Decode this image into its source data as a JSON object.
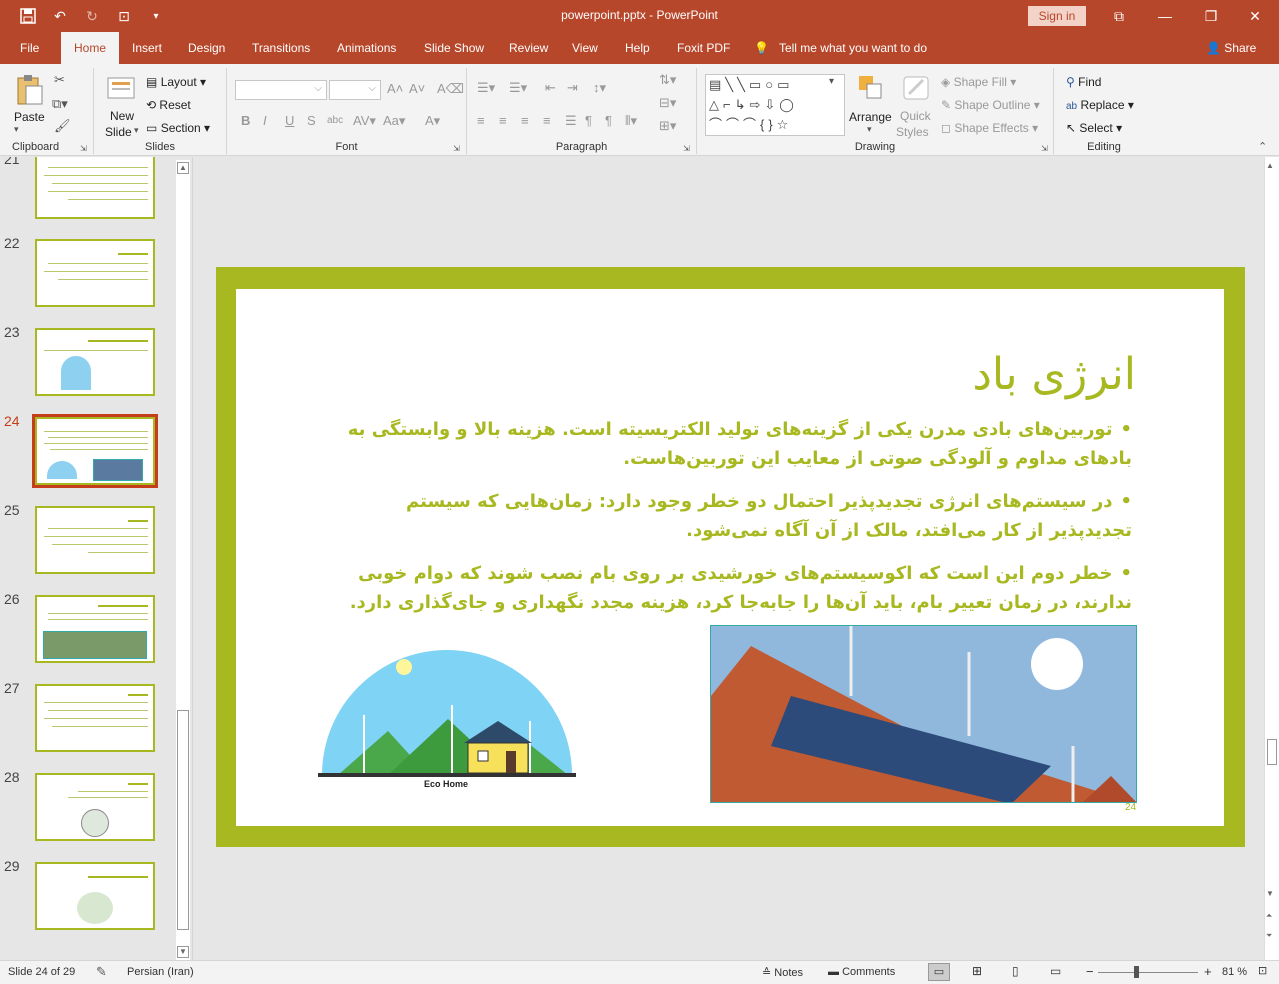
{
  "window": {
    "title": "powerpoint.pptx - PowerPoint",
    "signin": "Sign in"
  },
  "tabs": [
    "File",
    "Home",
    "Insert",
    "Design",
    "Transitions",
    "Animations",
    "Slide Show",
    "Review",
    "View",
    "Help",
    "Foxit PDF"
  ],
  "active_tab": "Home",
  "tell_me": "Tell me what you want to do",
  "share": "Share",
  "ribbon": {
    "clipboard": {
      "label": "Clipboard",
      "paste": "Paste"
    },
    "slides": {
      "label": "Slides",
      "new_slide_1": "New",
      "new_slide_2": "Slide",
      "layout": "Layout",
      "reset": "Reset",
      "section": "Section"
    },
    "font": {
      "label": "Font"
    },
    "paragraph": {
      "label": "Paragraph"
    },
    "drawing": {
      "label": "Drawing",
      "arrange": "Arrange",
      "quick_styles_1": "Quick",
      "quick_styles_2": "Styles",
      "shape_fill": "Shape Fill",
      "shape_outline": "Shape Outline",
      "shape_effects": "Shape Effects"
    },
    "editing": {
      "label": "Editing",
      "find": "Find",
      "replace": "Replace",
      "select": "Select"
    }
  },
  "thumbnails": {
    "numbers": [
      "21",
      "22",
      "23",
      "24",
      "25",
      "26",
      "27",
      "28",
      "29"
    ],
    "selected": "24"
  },
  "slide": {
    "title": "انرژی باد",
    "bullets": [
      "توربین‌های بادی مدرن یکی از گزینه‌های تولید الکتریسیته است. هزینه بالا و وابستگی به بادهای مداوم و آلودگی صوتی از معایب این توربین‌هاست.",
      "در سیستم‌های انرژی تجدیدپذیر احتمال دو خطر وجود دارد: زمان‌هایی که سیستم تجدیدپذیر از کار می‌افتد، مالک از آن آگاه نمی‌شود.",
      "خطر دوم این است که اکوسیستم‌های خورشیدی بر روی بام نصب شوند که دوام خوبی ندارند، در زمان تعییر بام، باید آن‌ها را جابه‌جا کرد، هزینه مجدد نگهداری و جای‌گذاری دارد."
    ],
    "image_caption": "Eco Home",
    "number": "24"
  },
  "status": {
    "slide_info": "Slide 24 of 29",
    "language": "Persian (Iran)",
    "notes": "Notes",
    "comments": "Comments",
    "zoom": "81 %"
  }
}
